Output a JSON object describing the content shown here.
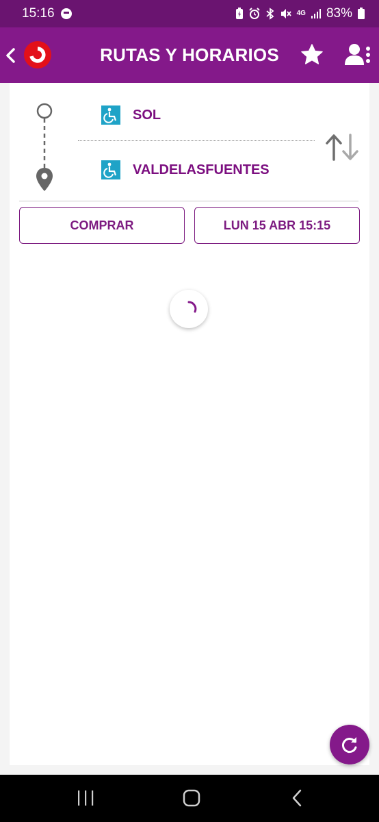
{
  "status_bar": {
    "time": "15:16",
    "network": "4G",
    "battery": "83%"
  },
  "app_bar": {
    "title": "RUTAS Y HORARIOS"
  },
  "route": {
    "origin": "SOL",
    "destination": "VALDELASFUENTES"
  },
  "actions": {
    "buy_label": "COMPRAR",
    "date_label": "LUN 15 ABR 15:15"
  },
  "colors": {
    "brand": "#84198a",
    "status_bar": "#6a1470",
    "accessible_icon": "#1fa3c7",
    "logo_red": "#e3101a"
  }
}
